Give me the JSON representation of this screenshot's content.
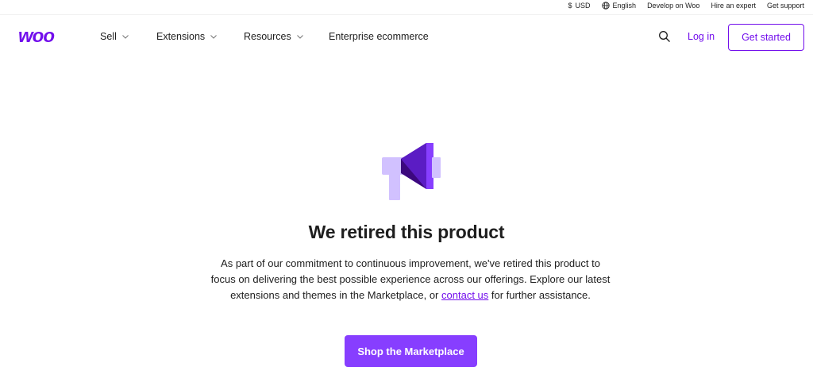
{
  "topbar": {
    "currency": "USD",
    "language": "English",
    "develop": "Develop on Woo",
    "hire": "Hire an expert",
    "support": "Get support"
  },
  "nav": {
    "logo_text": "woo",
    "sell": "Sell",
    "extensions": "Extensions",
    "resources": "Resources",
    "enterprise": "Enterprise ecommerce",
    "login": "Log in",
    "get_started": "Get started"
  },
  "content": {
    "icon": "megaphone-icon",
    "heading": "We retired this product",
    "desc_part1": "As part of our commitment to continuous improvement, we've retired this product to focus on delivering the best possible experience across our offerings. Explore our latest extensions and themes in the Marketplace, or ",
    "desc_link": "contact us",
    "desc_part2": " for further assistance.",
    "cta": "Shop the Marketplace"
  },
  "colors": {
    "brand": "#720eec",
    "button": "#873eff",
    "icon_light": "#d1c1ff",
    "icon_dark": "#3c087e"
  }
}
